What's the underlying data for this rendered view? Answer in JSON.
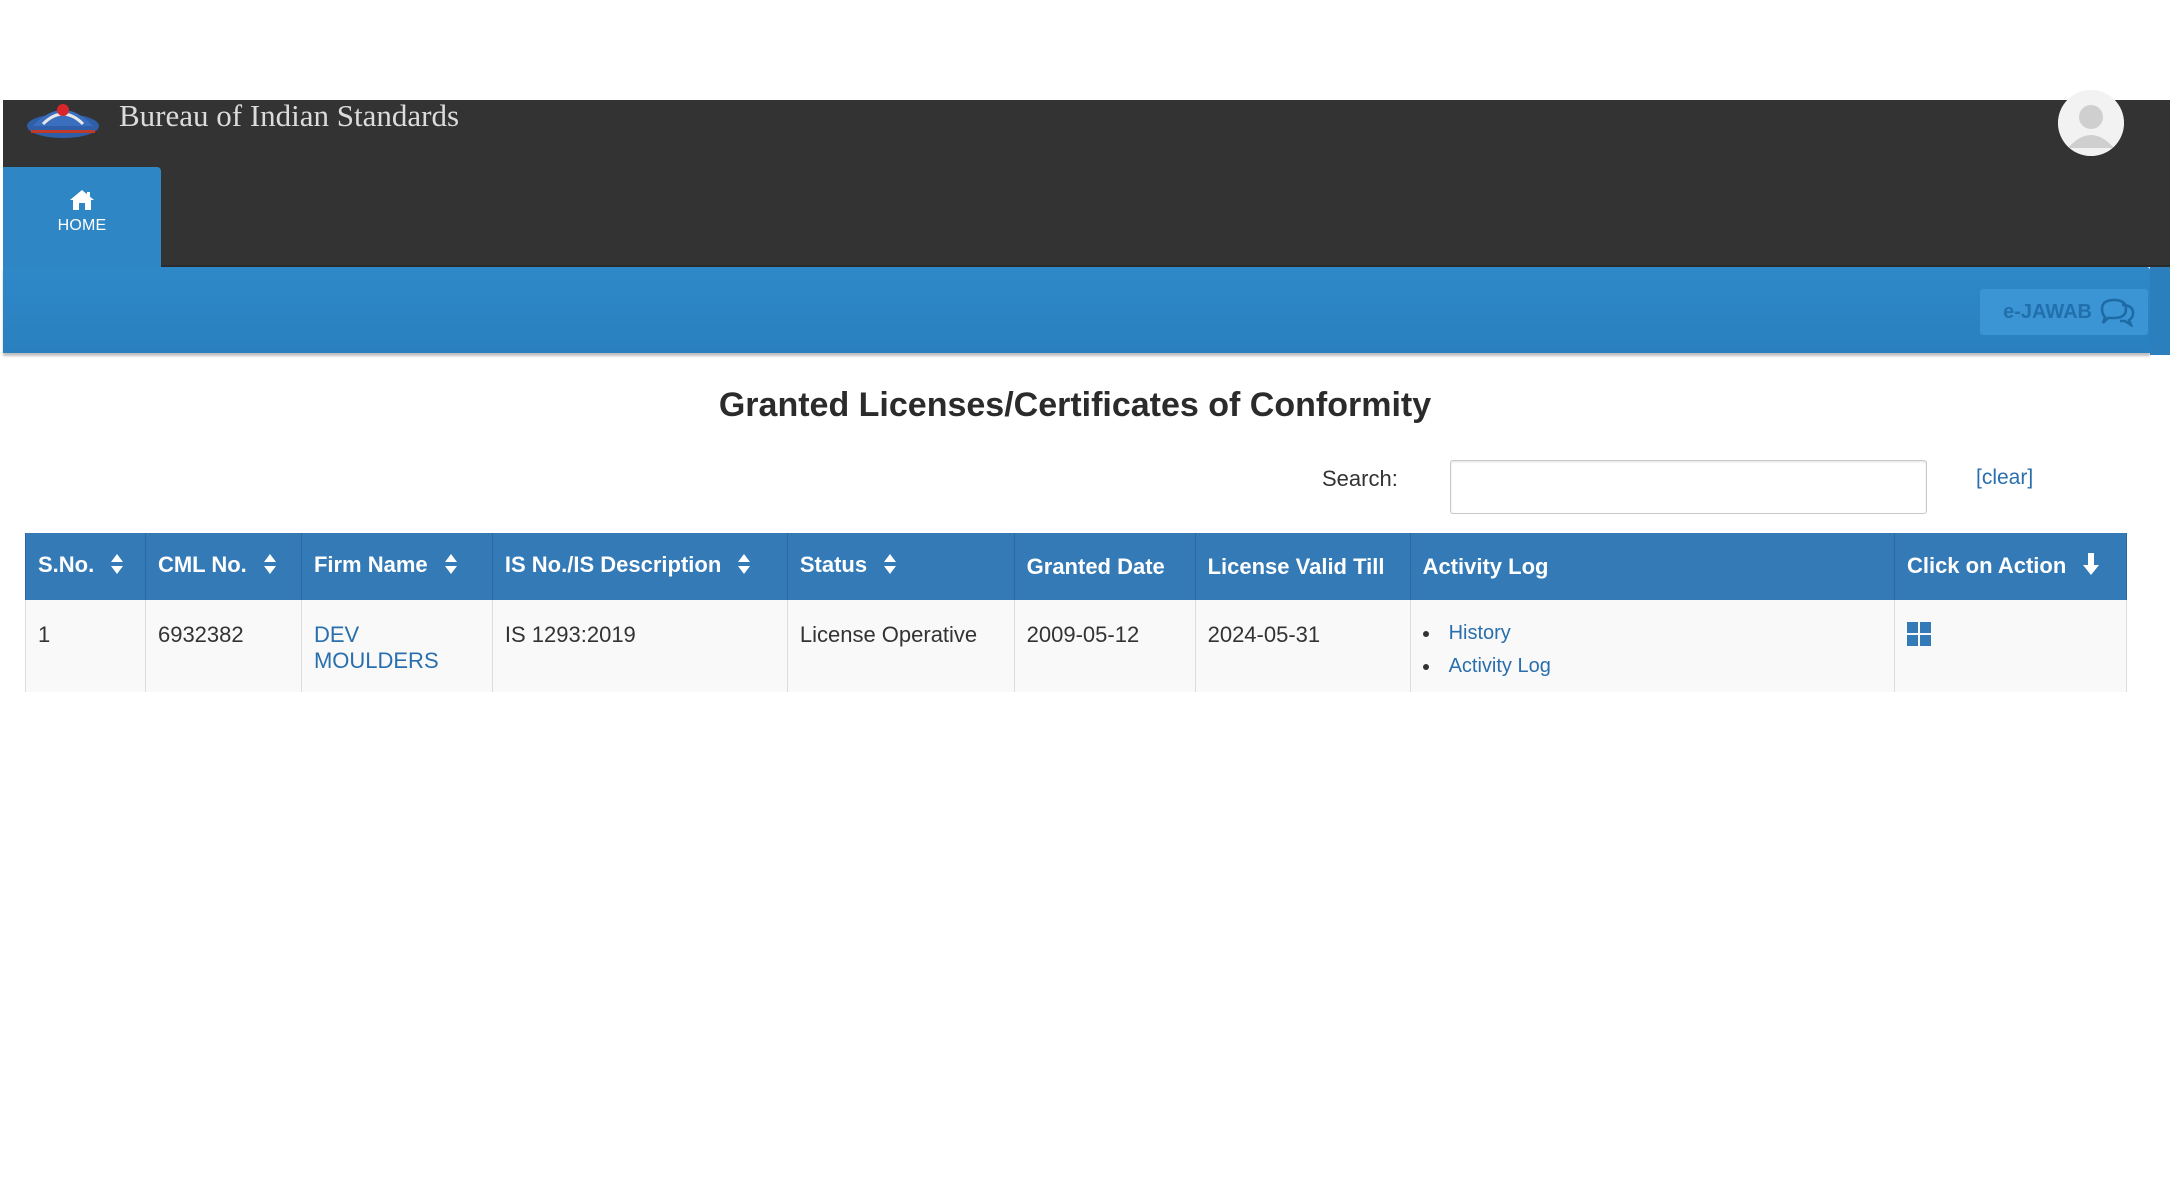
{
  "header": {
    "org_name": "Bureau of Indian Standards",
    "home_label": "HOME",
    "ejawab_label": "e-JAWAB"
  },
  "main": {
    "title": "Granted Licenses/Certificates of Conformity",
    "search": {
      "label": "Search:",
      "value": "",
      "placeholder": "",
      "clear_label": "[clear]"
    },
    "table": {
      "columns": [
        "S.No.",
        "CML No.",
        "Firm Name",
        "IS No./IS Description",
        "Status",
        "Granted Date",
        "License Valid Till",
        "Activity Log",
        "Click on Action"
      ],
      "rows": [
        {
          "sno": "1",
          "cml_no": "6932382",
          "firm_name": "DEV MOULDERS",
          "is_no": "IS 1293:2019",
          "status": "License Operative",
          "granted_date": "2009-05-12",
          "valid_till": "2024-05-31",
          "activity_links": [
            "History",
            "Activity Log"
          ]
        }
      ]
    }
  },
  "colors": {
    "topbar": "#333333",
    "accent_blue": "#337ab7",
    "link": "#2a6fad"
  },
  "icons": {
    "logo": "bis-logo-icon",
    "home": "home-icon",
    "user": "user-avatar-icon",
    "chat": "chat-bubbles-icon",
    "sort": "sort-icon",
    "arrow_down": "arrow-down-icon",
    "action": "grid-icon"
  }
}
